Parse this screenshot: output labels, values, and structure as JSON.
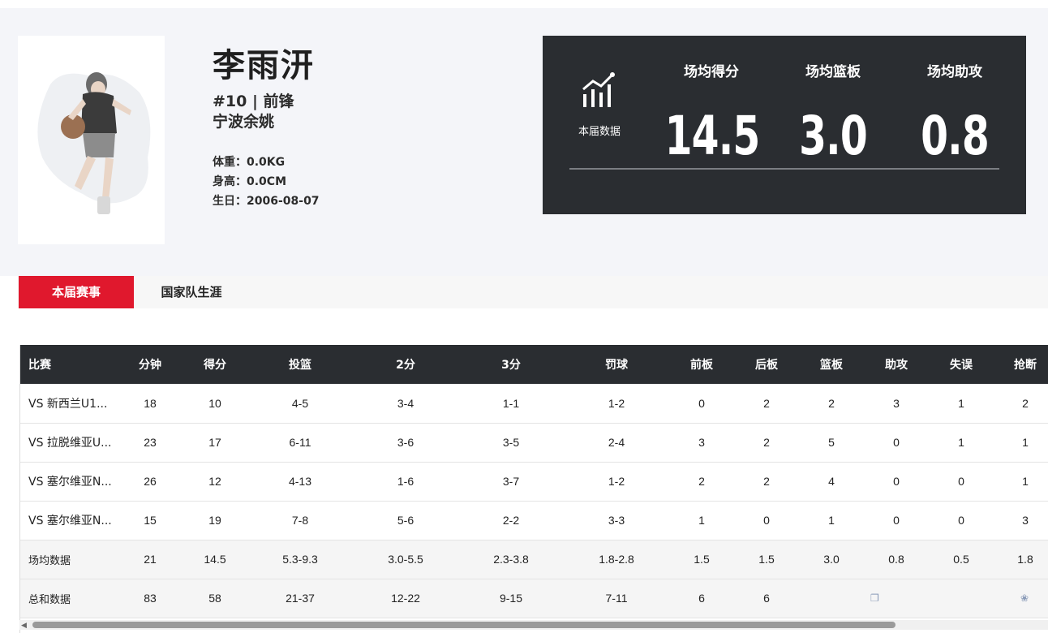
{
  "player": {
    "name": "李雨汧",
    "number_position": "#10 | 前锋",
    "team": "宁波余姚",
    "weight": "体重：0.0KG",
    "height": "身高：0.0CM",
    "birthday": "生日：2006-08-07"
  },
  "season_stats": {
    "icon": "bar-chart-trend-icon",
    "icon_label": "本届数据",
    "items": [
      {
        "label": "场均得分",
        "value": "14.5"
      },
      {
        "label": "场均篮板",
        "value": "3.0"
      },
      {
        "label": "场均助攻",
        "value": "0.8"
      }
    ]
  },
  "tabs": [
    {
      "label": "本届赛事",
      "active": true
    },
    {
      "label": "国家队生涯",
      "active": false
    }
  ],
  "table": {
    "headers": [
      "比赛",
      "分钟",
      "得分",
      "投篮",
      "2分",
      "3分",
      "罚球",
      "前板",
      "后板",
      "篮板",
      "助攻",
      "失误",
      "抢断"
    ],
    "rows": [
      [
        "VS 新西兰U1...",
        "18",
        "10",
        "4-5",
        "3-4",
        "1-1",
        "1-2",
        "0",
        "2",
        "2",
        "3",
        "1",
        "2"
      ],
      [
        "VS 拉脱维亚U...",
        "23",
        "17",
        "6-11",
        "3-6",
        "3-5",
        "2-4",
        "3",
        "2",
        "5",
        "0",
        "1",
        "1"
      ],
      [
        "VS 塞尔维亚N...",
        "26",
        "12",
        "4-13",
        "1-6",
        "3-7",
        "1-2",
        "2",
        "2",
        "4",
        "0",
        "0",
        "1"
      ],
      [
        "VS 塞尔维亚N...",
        "15",
        "19",
        "7-8",
        "5-6",
        "2-2",
        "3-3",
        "1",
        "0",
        "1",
        "0",
        "0",
        "3"
      ],
      [
        "场均数据",
        "21",
        "14.5",
        "5.3-9.3",
        "3.0-5.5",
        "2.3-3.8",
        "1.8-2.8",
        "1.5",
        "1.5",
        "3.0",
        "0.8",
        "0.5",
        "1.8"
      ],
      [
        "总和数据",
        "83",
        "58",
        "21-37",
        "12-22",
        "9-15",
        "7-11",
        "6",
        "6",
        "",
        "",
        "",
        ""
      ]
    ]
  },
  "colors": {
    "accent_red": "#e0182d",
    "dark_panel": "#2a2d31",
    "page_bg": "#f4f5f9"
  }
}
